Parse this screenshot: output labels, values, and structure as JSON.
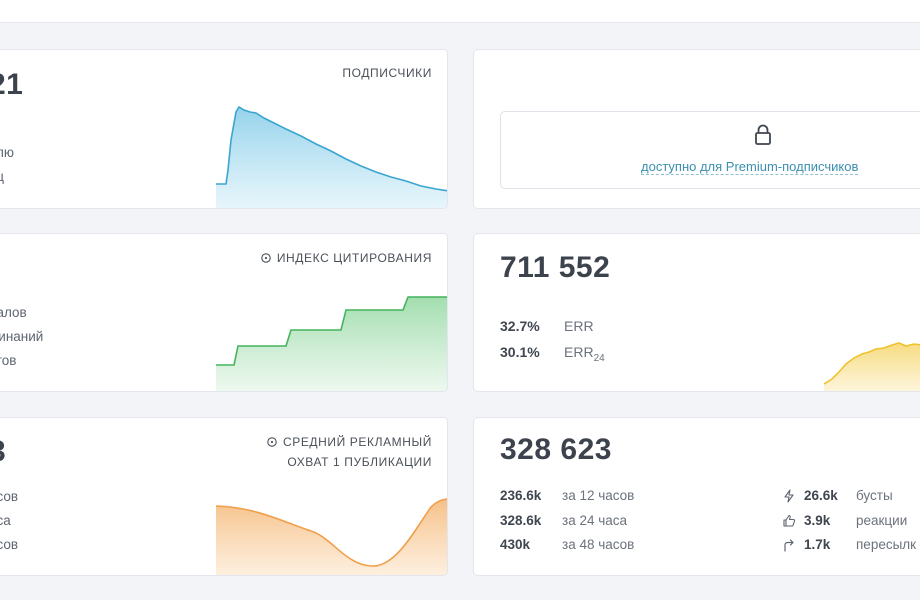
{
  "subscribers": {
    "big_number": "21",
    "title": "подписчики",
    "lines": [
      "я",
      "елю",
      "яц"
    ]
  },
  "premium": {
    "link_text": "доступно для Premium-подписчиков",
    "icon": "lock-icon"
  },
  "citation": {
    "title": "индекс цитирования",
    "icon": "info-icon",
    "lines": [
      "налов",
      "минаний",
      "стов"
    ]
  },
  "views": {
    "big_number": "711 552",
    "err": {
      "value": "32.7%",
      "label": "ERR"
    },
    "err24": {
      "value": "30.1%",
      "label": "ERR",
      "sub": "24"
    }
  },
  "ad_reach": {
    "big_number": "3",
    "title_line1": "средний рекламный",
    "title_line2": "охват 1 публикации",
    "icon": "info-icon",
    "lines": [
      "асов",
      "аса",
      "асов"
    ]
  },
  "reach": {
    "big_number": "328 623",
    "rows": [
      {
        "value": "236.6k",
        "label": "за 12 часов"
      },
      {
        "value": "328.6k",
        "label": "за 24 часа"
      },
      {
        "value": "430k",
        "label": "за 48 часов"
      }
    ],
    "actions": [
      {
        "icon": "lightning-icon",
        "value": "26.6k",
        "label": "бусты"
      },
      {
        "icon": "thumbs-up-icon",
        "value": "3.9k",
        "label": "реакции"
      },
      {
        "icon": "share-arrow-icon",
        "value": "1.7k",
        "label": "пересылк"
      }
    ]
  },
  "colors": {
    "blue": "#3aa6cf",
    "green": "#44b45c",
    "yellow": "#f0c22a",
    "orange": "#f0a04b"
  }
}
